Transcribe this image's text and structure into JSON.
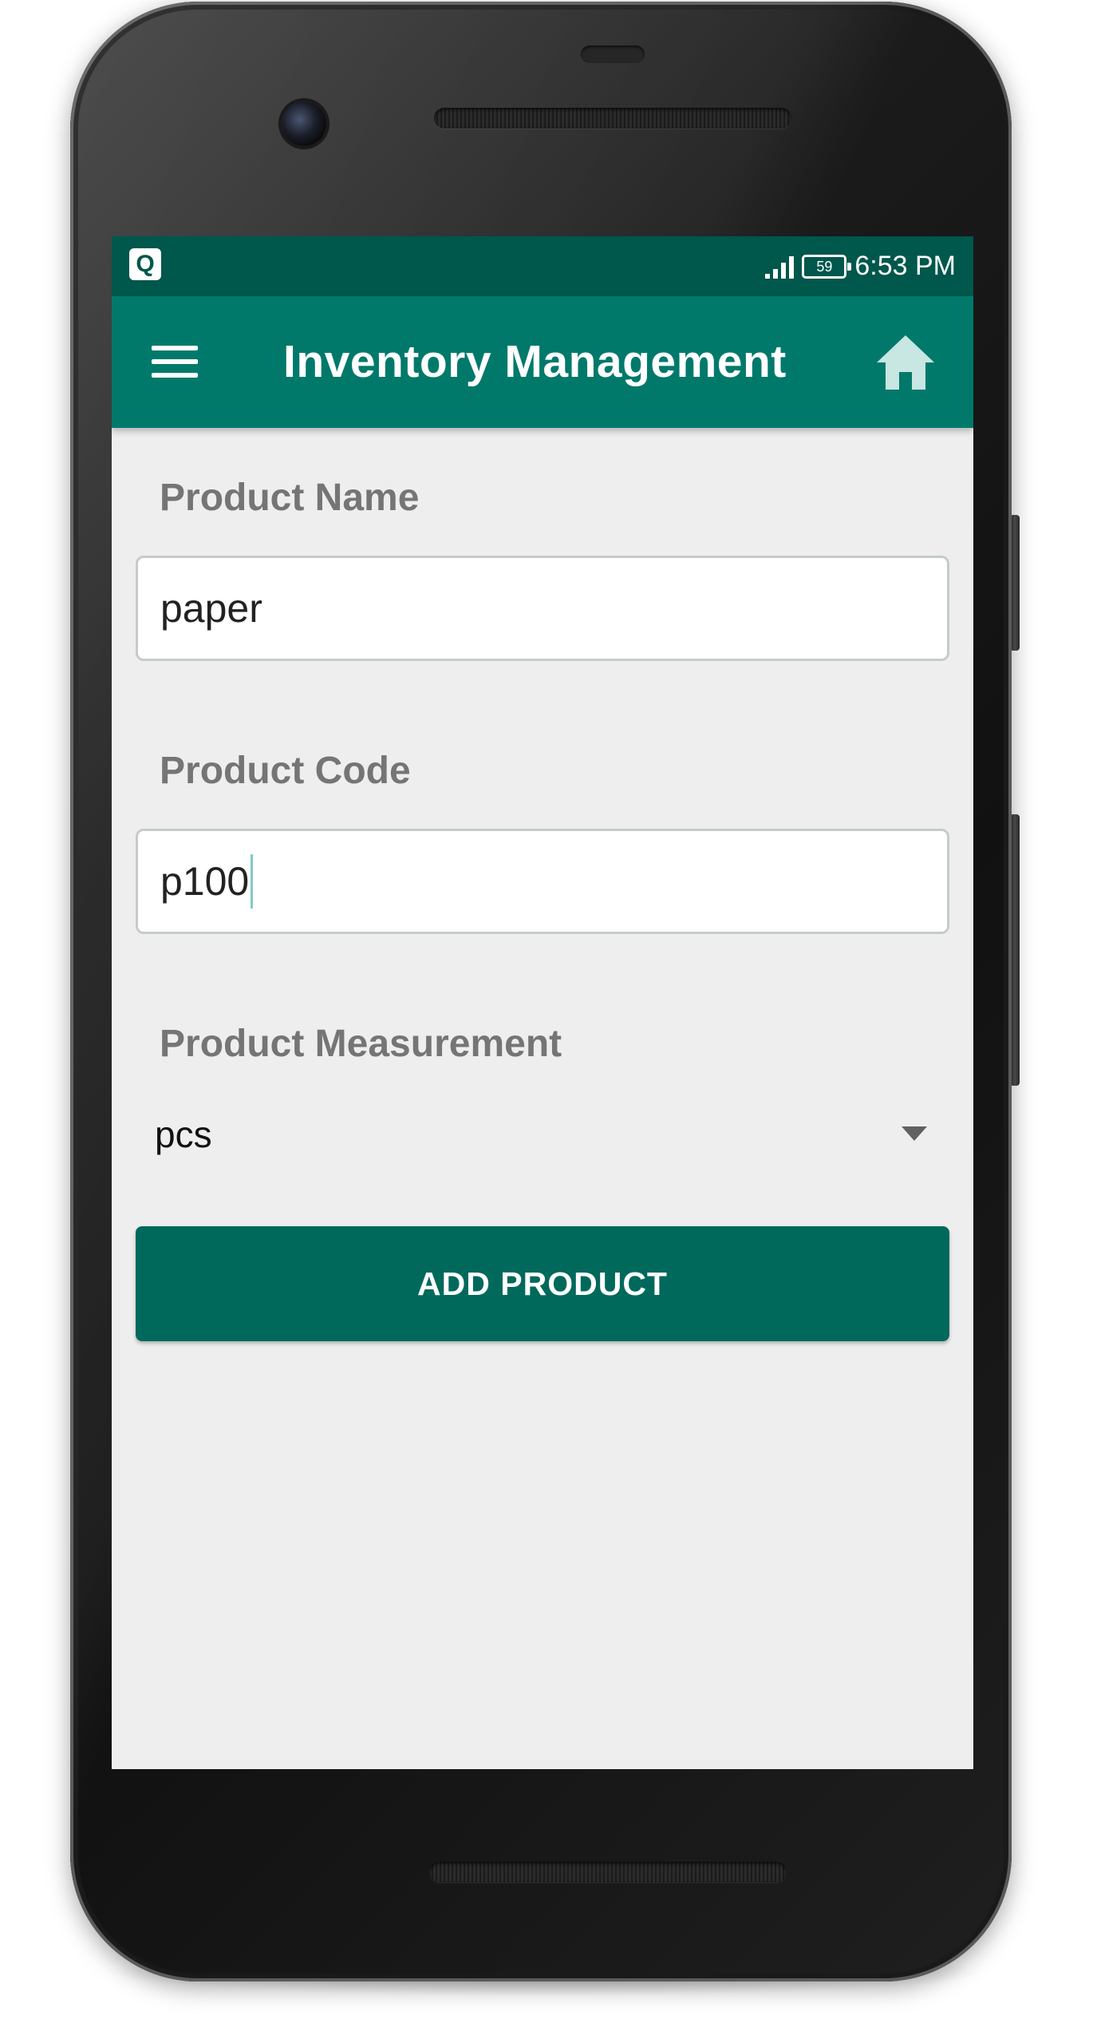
{
  "status_bar": {
    "app_icon_letter": "Q",
    "battery_level": "59",
    "time": "6:53 PM"
  },
  "app_bar": {
    "title": "Inventory Management",
    "menu_icon": "hamburger-menu-icon",
    "home_icon": "home-icon"
  },
  "form": {
    "product_name": {
      "label": "Product Name",
      "value": "paper"
    },
    "product_code": {
      "label": "Product Code",
      "value": "p100"
    },
    "product_measurement": {
      "label": "Product Measurement",
      "selected": "pcs"
    },
    "submit_label": "ADD PRODUCT"
  },
  "colors": {
    "status_bar": "#00574b",
    "app_bar": "#00796b",
    "button": "#00695c",
    "background": "#eeeeee",
    "label": "#757575"
  }
}
